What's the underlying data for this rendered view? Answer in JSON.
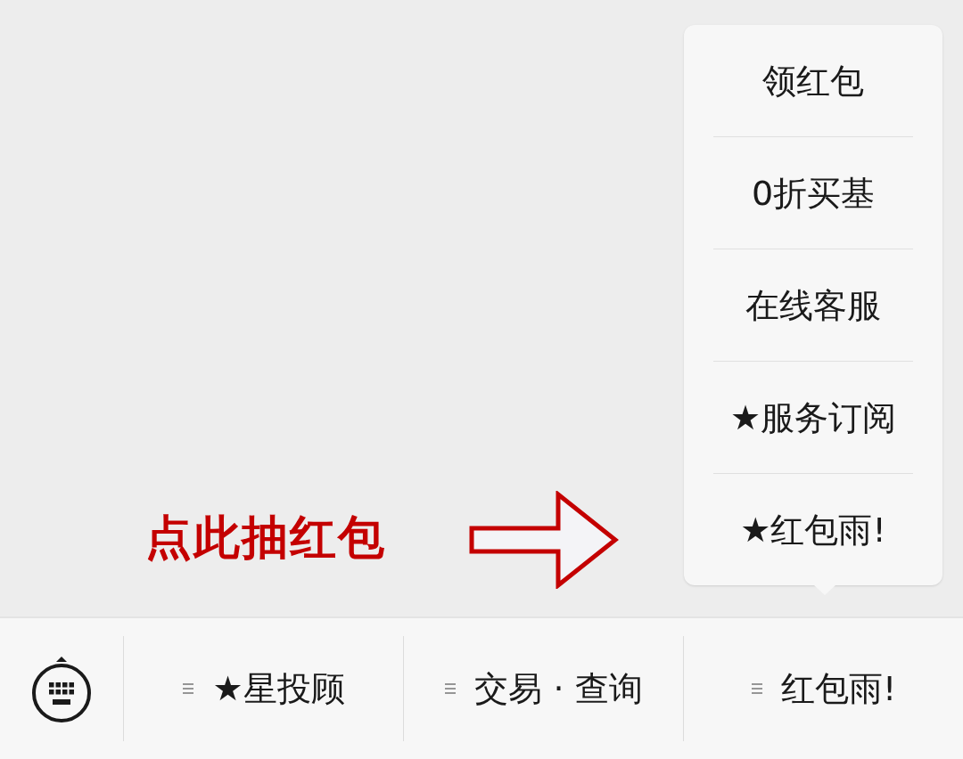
{
  "popup_menu": {
    "items": [
      {
        "label": "领红包"
      },
      {
        "label": "0折买基"
      },
      {
        "label": "在线客服"
      },
      {
        "label": "★服务订阅"
      },
      {
        "label": "★红包雨!"
      }
    ]
  },
  "annotation": {
    "text": "点此抽红包"
  },
  "bottom_menu": {
    "items": [
      {
        "label": "★星投顾"
      },
      {
        "label": "交易 · 查询"
      },
      {
        "label": "红包雨!"
      }
    ]
  }
}
